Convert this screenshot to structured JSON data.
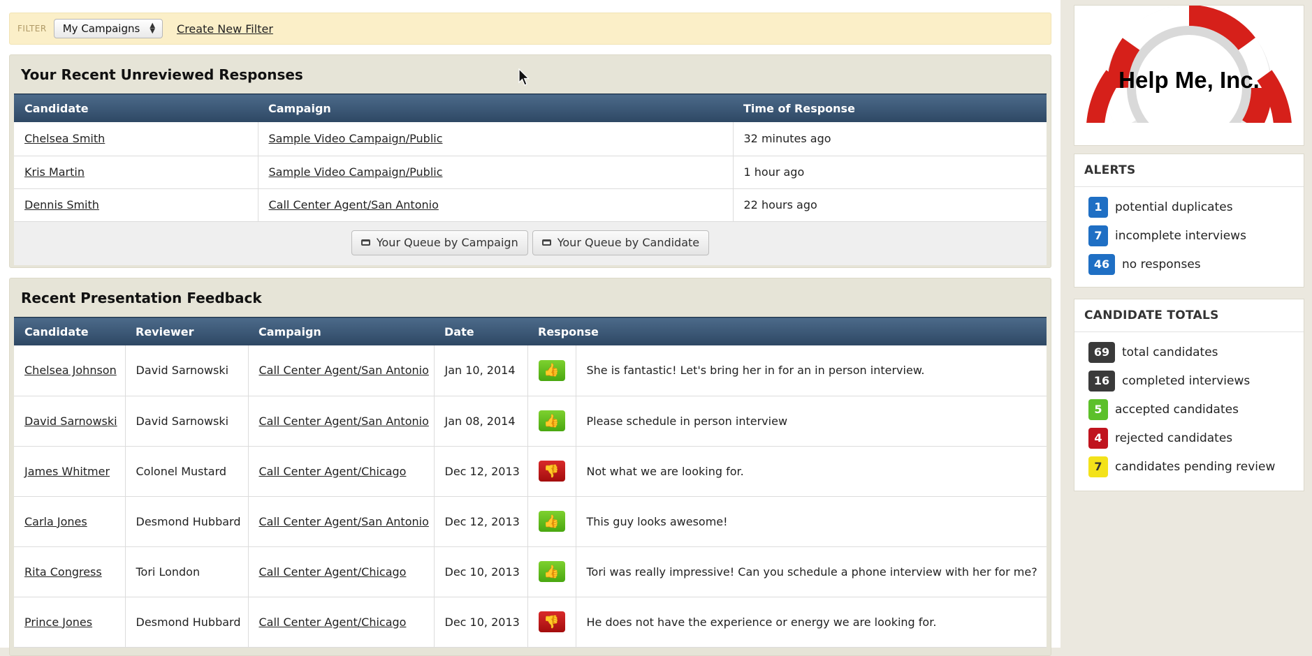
{
  "filter": {
    "label": "FILTER",
    "selected": "My Campaigns",
    "create_link": "Create New Filter"
  },
  "unreviewed": {
    "title": "Your Recent Unreviewed Responses",
    "columns": [
      "Candidate",
      "Campaign",
      "Time of Response"
    ],
    "rows": [
      {
        "candidate": "Chelsea Smith",
        "campaign": "Sample Video Campaign/Public",
        "time": "32 minutes ago"
      },
      {
        "candidate": "Kris Martin",
        "campaign": "Sample Video Campaign/Public",
        "time": "1 hour ago"
      },
      {
        "candidate": "Dennis Smith",
        "campaign": "Call Center Agent/San Antonio",
        "time": "22 hours ago"
      }
    ],
    "queue_by_campaign": "Your Queue by Campaign",
    "queue_by_candidate": "Your Queue by Candidate"
  },
  "feedback": {
    "title": "Recent Presentation Feedback",
    "columns": [
      "Candidate",
      "Reviewer",
      "Campaign",
      "Date",
      "Response"
    ],
    "rows": [
      {
        "candidate": "Chelsea Johnson",
        "reviewer": "David Sarnowski",
        "campaign": "Call Center Agent/San Antonio",
        "date": "Jan 10, 2014",
        "vote": "up",
        "comment": "She is fantastic! Let's bring her in for an in person interview."
      },
      {
        "candidate": "David Sarnowski",
        "reviewer": "David Sarnowski",
        "campaign": "Call Center Agent/San Antonio",
        "date": "Jan 08, 2014",
        "vote": "up",
        "comment": "Please schedule in person interview"
      },
      {
        "candidate": "James Whitmer",
        "reviewer": "Colonel Mustard",
        "campaign": "Call Center Agent/Chicago",
        "date": "Dec 12, 2013",
        "vote": "down",
        "comment": "Not what we are looking for."
      },
      {
        "candidate": "Carla Jones",
        "reviewer": "Desmond Hubbard",
        "campaign": "Call Center Agent/San Antonio",
        "date": "Dec 12, 2013",
        "vote": "up",
        "comment": "This guy looks awesome!"
      },
      {
        "candidate": "Rita Congress",
        "reviewer": "Tori London",
        "campaign": "Call Center Agent/Chicago",
        "date": "Dec 10, 2013",
        "vote": "up",
        "comment": "Tori was really impressive! Can you schedule a phone interview with her for me?"
      },
      {
        "candidate": "Prince Jones",
        "reviewer": "Desmond Hubbard",
        "campaign": "Call Center Agent/Chicago",
        "date": "Dec 10, 2013",
        "vote": "down",
        "comment": "He does not have the experience or energy we are looking for."
      }
    ]
  },
  "logo": {
    "text": "Help Me, Inc."
  },
  "alerts": {
    "title": "ALERTS",
    "items": [
      {
        "count": "1",
        "label": "potential duplicates",
        "color": "#1f6fc4"
      },
      {
        "count": "7",
        "label": "incomplete interviews",
        "color": "#1f6fc4"
      },
      {
        "count": "46",
        "label": "no responses",
        "color": "#1f6fc4"
      }
    ]
  },
  "totals": {
    "title": "CANDIDATE TOTALS",
    "items": [
      {
        "count": "69",
        "label": "total candidates",
        "color": "#3a3a3a"
      },
      {
        "count": "16",
        "label": "completed interviews",
        "color": "#3a3a3a"
      },
      {
        "count": "5",
        "label": "accepted candidates",
        "color": "#5cc02a"
      },
      {
        "count": "4",
        "label": "rejected candidates",
        "color": "#c0141e"
      },
      {
        "count": "7",
        "label": "candidates pending review",
        "color": "#f3e21a"
      }
    ]
  }
}
